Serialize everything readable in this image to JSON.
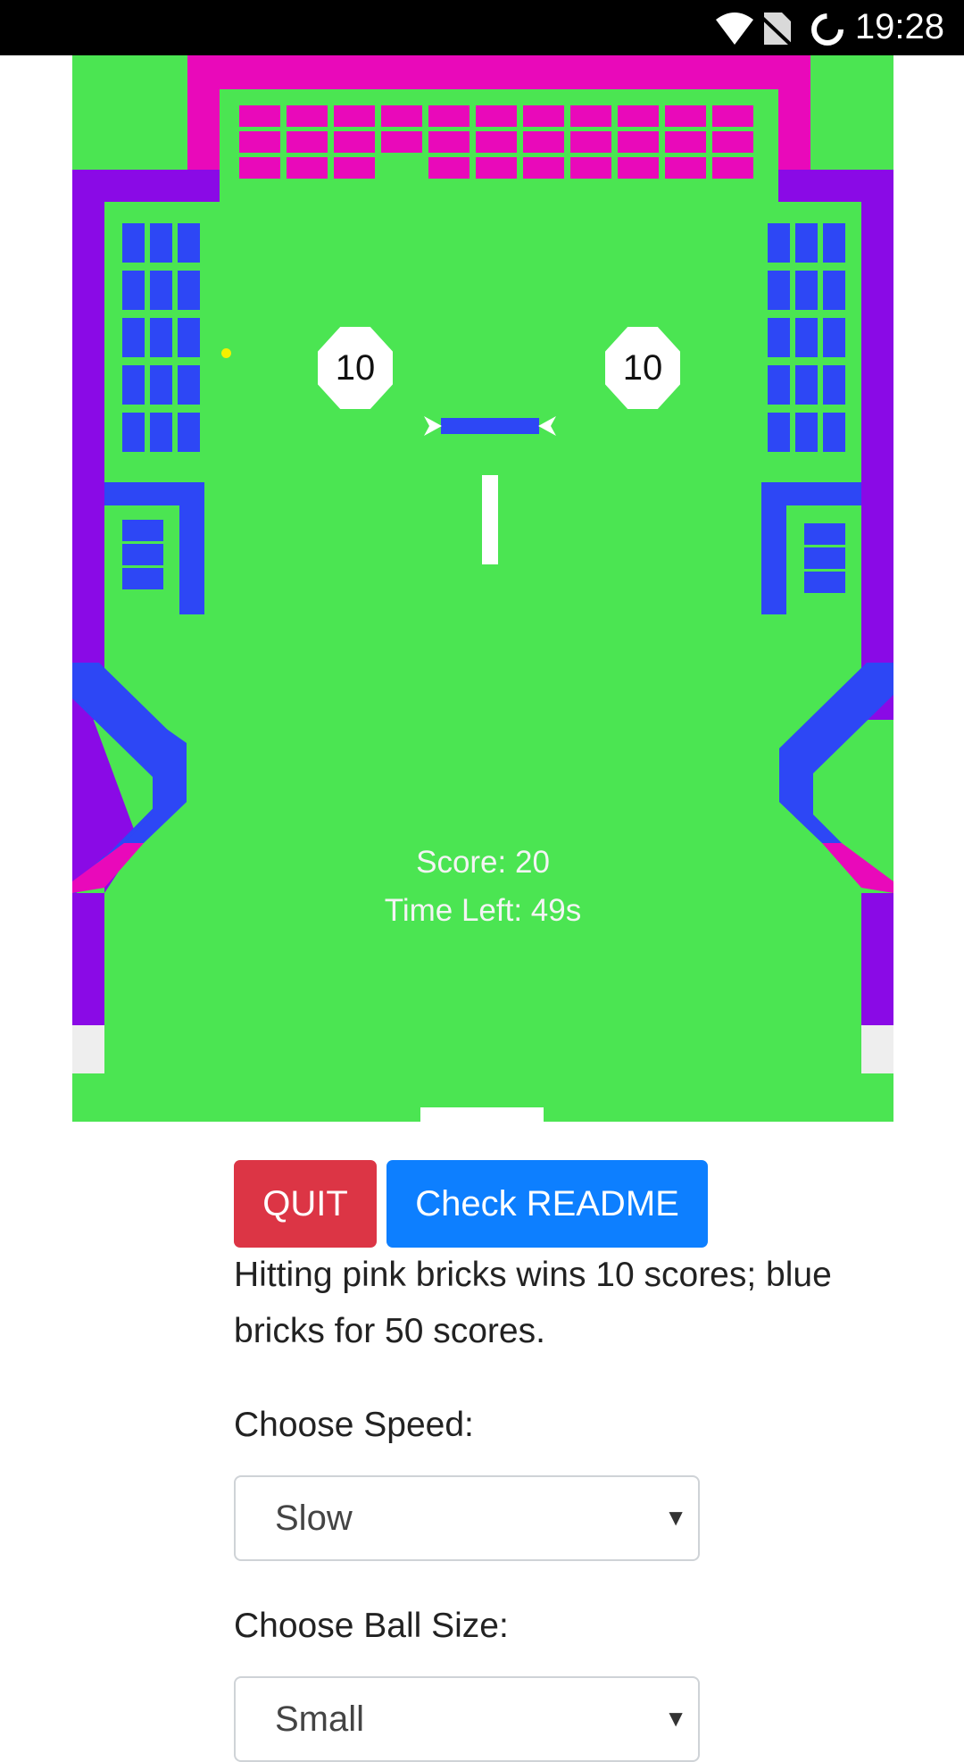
{
  "status_bar": {
    "time": "19:28",
    "icons": [
      "wifi-icon",
      "no-sim-icon",
      "loading-circle-icon"
    ]
  },
  "game": {
    "bumper_left_value": "10",
    "bumper_right_value": "10",
    "score_text": "Score: 20",
    "time_left_text": "Time Left: 49s",
    "colors": {
      "field": "#4be552",
      "pink_brick": "#e909ba",
      "wall": "#8a0ae6",
      "blue_brick": "#2d47f5",
      "ball": "#f4f000"
    }
  },
  "controls": {
    "quit_label": "QUIT",
    "readme_label": "Check README",
    "info_text": "Hitting pink bricks wins 10 scores; blue bricks for 50 scores.",
    "speed_label": "Choose Speed:",
    "speed_value": "Slow",
    "ball_size_label": "Choose Ball Size:",
    "ball_size_value": "Small"
  }
}
